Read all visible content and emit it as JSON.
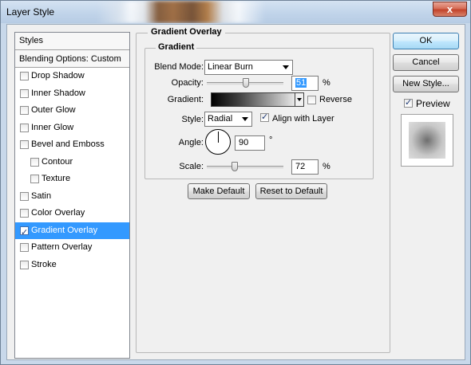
{
  "window": {
    "title": "Layer Style",
    "close_glyph": "x"
  },
  "style_list": {
    "header": "Styles",
    "blending_options": "Blending Options: Custom",
    "items": [
      {
        "label": "Drop Shadow",
        "checked": false,
        "sub": false,
        "selected": false
      },
      {
        "label": "Inner Shadow",
        "checked": false,
        "sub": false,
        "selected": false
      },
      {
        "label": "Outer Glow",
        "checked": false,
        "sub": false,
        "selected": false
      },
      {
        "label": "Inner Glow",
        "checked": false,
        "sub": false,
        "selected": false
      },
      {
        "label": "Bevel and Emboss",
        "checked": false,
        "sub": false,
        "selected": false
      },
      {
        "label": "Contour",
        "checked": false,
        "sub": true,
        "selected": false
      },
      {
        "label": "Texture",
        "checked": false,
        "sub": true,
        "selected": false
      },
      {
        "label": "Satin",
        "checked": false,
        "sub": false,
        "selected": false
      },
      {
        "label": "Color Overlay",
        "checked": false,
        "sub": false,
        "selected": false
      },
      {
        "label": "Gradient Overlay",
        "checked": true,
        "sub": false,
        "selected": true
      },
      {
        "label": "Pattern Overlay",
        "checked": false,
        "sub": false,
        "selected": false
      },
      {
        "label": "Stroke",
        "checked": false,
        "sub": false,
        "selected": false
      }
    ]
  },
  "panel": {
    "title": "Gradient Overlay",
    "group_title": "Gradient",
    "blend_mode": {
      "label": "Blend Mode:",
      "value": "Linear Burn"
    },
    "opacity": {
      "label": "Opacity:",
      "value": "51",
      "unit": "%",
      "level": 0.51
    },
    "gradient": {
      "label": "Gradient:",
      "reverse_label": "Reverse",
      "reverse_checked": false
    },
    "style": {
      "label": "Style:",
      "value": "Radial",
      "align_label": "Align with Layer",
      "align_checked": true
    },
    "angle": {
      "label": "Angle:",
      "value": "90",
      "unit": "°"
    },
    "scale": {
      "label": "Scale:",
      "value": "72",
      "unit": "%",
      "level": 0.36
    },
    "make_default": "Make Default",
    "reset_default": "Reset to Default"
  },
  "buttons": {
    "ok": "OK",
    "cancel": "Cancel",
    "new_style": "New Style...",
    "preview_label": "Preview",
    "preview_checked": true
  },
  "colors": {
    "selection": "#3399ff",
    "titlebar": "#c8d8ea",
    "close_button": "#c2432b"
  }
}
